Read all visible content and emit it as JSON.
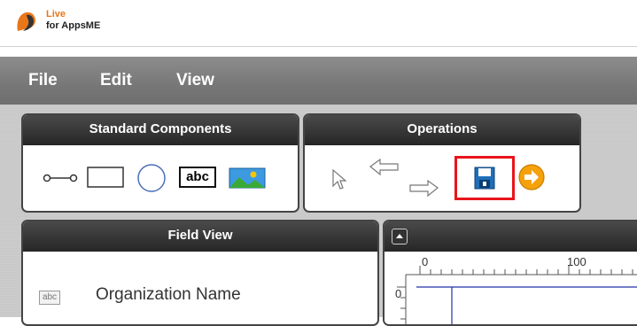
{
  "logo": {
    "line1": "Live",
    "line2": "for AppsME",
    "icon": "live-logo-icon"
  },
  "menu": {
    "items": [
      "File",
      "Edit",
      "View"
    ]
  },
  "panels": {
    "standard": {
      "title": "Standard Components",
      "tools": [
        "connector-icon",
        "rectangle-icon",
        "circle-icon",
        "text-icon",
        "image-icon"
      ],
      "text_tool_label": "abc"
    },
    "operations": {
      "title": "Operations",
      "tools": [
        "pointer-icon",
        "undo-arrow-icon",
        "redo-arrow-icon",
        "save-icon",
        "go-arrow-icon"
      ],
      "highlighted": "save-icon",
      "highlight_color": "#e8141b"
    },
    "field_view": {
      "title": "Field View",
      "rows": [
        {
          "icon": "textfield-icon",
          "icon_label": "abc",
          "label": "Organization Name"
        }
      ]
    },
    "canvas": {
      "collapse_icon": "collapse-up-icon",
      "ruler_ticks": [
        "0",
        "100"
      ],
      "vertical_ticks": [
        "0"
      ]
    }
  },
  "colors": {
    "logo_orange": "#e8771a",
    "menu_bg": "#7f7f7f",
    "panel_header": "#333333",
    "save_highlight": "#e8141b",
    "go_arrow": "#f5a10a",
    "floppy_blue": "#1f6fb8"
  }
}
